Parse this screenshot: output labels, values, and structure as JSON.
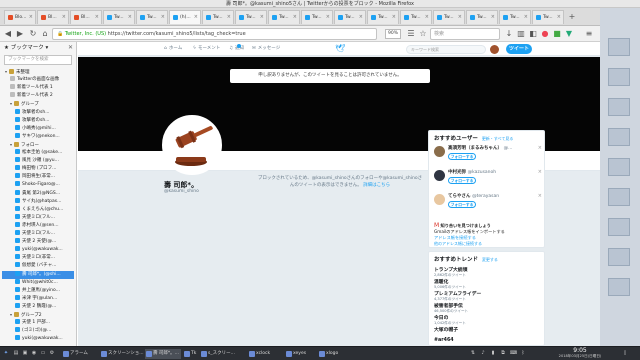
{
  "window": {
    "title": "壽 司郎*。@kasumi_shino5さん | Twitterからの投票をブロック - Mozilla Firefox"
  },
  "tabs": [
    {
      "label": "Blo...",
      "favicon": "ff"
    },
    {
      "label": "Bl...",
      "favicon": "ff"
    },
    {
      "label": "Bl...",
      "favicon": "ff"
    },
    {
      "label": "Tw...",
      "favicon": "tw"
    },
    {
      "label": "Tw...",
      "favicon": "tw"
    },
    {
      "label": "(h)...",
      "favicon": "tw"
    },
    {
      "label": "Tw...",
      "favicon": "tw"
    },
    {
      "label": "Tw...",
      "favicon": "tw"
    },
    {
      "label": "Tw...",
      "favicon": "tw"
    },
    {
      "label": "Tw...",
      "favicon": "tw"
    },
    {
      "label": "Tw...",
      "favicon": "tw"
    },
    {
      "label": "Tw...",
      "favicon": "tw"
    },
    {
      "label": "Tw...",
      "favicon": "tw"
    },
    {
      "label": "Tw...",
      "favicon": "tw"
    },
    {
      "label": "Tw...",
      "favicon": "tw"
    },
    {
      "label": "Tw...",
      "favicon": "tw"
    },
    {
      "label": "Tw...",
      "favicon": "tw"
    }
  ],
  "nav": {
    "url_org": "Twitter, Inc. (US)",
    "url": "https://twitter.com/kasumi_shino5/lists/tag_check=true",
    "zoom": "90%",
    "search_placeholder": "検索"
  },
  "sidebar": {
    "title": "ブックマーク",
    "search_placeholder": "ブックマークを検索",
    "items": [
      {
        "label": "未整理",
        "kind": "folder",
        "indent": 1
      },
      {
        "label": "Twitterの画面な画像",
        "kind": "page",
        "indent": 2
      },
      {
        "label": "新着ツール代表 1",
        "kind": "page",
        "indent": 2
      },
      {
        "label": "新着ツール代表 2",
        "kind": "page",
        "indent": 2
      },
      {
        "label": "グループ",
        "kind": "folder",
        "indent": 2
      },
      {
        "label": "攻撃者のsh...",
        "kind": "tw",
        "indent": 3
      },
      {
        "label": "攻撃者のsh...",
        "kind": "tw",
        "indent": 3
      },
      {
        "label": "小嶋秀(@mihi...",
        "kind": "tw",
        "indent": 3
      },
      {
        "label": "サキワ(@nekon...",
        "kind": "tw",
        "indent": 3
      },
      {
        "label": "フォロー",
        "kind": "folder",
        "indent": 2
      },
      {
        "label": "松本圭佑 (@sake...",
        "kind": "tw",
        "indent": 3
      },
      {
        "label": "風見 沙羅 (@yu...",
        "kind": "tw",
        "indent": 3
      },
      {
        "label": "梅田物 (プロフ...",
        "kind": "tw",
        "indent": 3
      },
      {
        "label": "岡田将生(非常...",
        "kind": "tw",
        "indent": 3
      },
      {
        "label": "Shoko-Figaro@...",
        "kind": "tw",
        "indent": 3
      },
      {
        "label": "貴尾 第2(@NGS...",
        "kind": "tw",
        "indent": 3
      },
      {
        "label": "サイ丸(@hatpas...",
        "kind": "tw",
        "indent": 3
      },
      {
        "label": "くまえちん(@chu...",
        "kind": "tw",
        "indent": 3
      },
      {
        "label": "天使ミロ(フル...",
        "kind": "tw",
        "indent": 3
      },
      {
        "label": "赤村瑛人(@sen...",
        "kind": "tw",
        "indent": 3
      },
      {
        "label": "天使ミロ(フル...",
        "kind": "tw",
        "indent": 3
      },
      {
        "label": "天使 2 天使(@...",
        "kind": "tw",
        "indent": 3
      },
      {
        "label": "yuki(@wakuwak...",
        "kind": "tw",
        "indent": 3
      },
      {
        "label": "天使ミロ(非常...",
        "kind": "tw",
        "indent": 3
      },
      {
        "label": "仮想愛 (バチャ...",
        "kind": "tw",
        "indent": 3
      },
      {
        "label": "壽 司郎*。(@shi...",
        "kind": "tw",
        "indent": 3,
        "selected": true
      },
      {
        "label": "Whit(@whit0c...",
        "kind": "tw",
        "indent": 3
      },
      {
        "label": "井上蓮馬(@yino...",
        "kind": "tw",
        "indent": 3
      },
      {
        "label": "米津 宇(@ulan...",
        "kind": "tw",
        "indent": 3
      },
      {
        "label": "天使 2 鶴霞(@...",
        "kind": "tw",
        "indent": 3
      },
      {
        "label": "グループ2",
        "kind": "folder",
        "indent": 2
      },
      {
        "label": "天使 1 戸部...",
        "kind": "tw",
        "indent": 3
      },
      {
        "label": "(ゴミ(ゴ)(@...",
        "kind": "tw",
        "indent": 3
      },
      {
        "label": "yuki(@wakuwak...",
        "kind": "tw",
        "indent": 3
      }
    ]
  },
  "twitter": {
    "nav": {
      "home": "ホーム",
      "moments": "モーメント",
      "notifications": "通知",
      "messages": "メッセージ",
      "search_placeholder": "キーワード検索",
      "tweet": "ツイート"
    },
    "blocked_banner": "申し訳ありませんが、このツイートを見ることは許可されていません。",
    "profile": {
      "name": "壽 司郎*。",
      "handle": "@kasumi_shino"
    },
    "block_notice": {
      "text": "ブロックされているため、@kasumi_shinoさんのフォローや@kasumi_shinoさんのツイートの表示はできません。",
      "link": "詳細はこちら"
    },
    "who_to_follow": {
      "title": "おすすめユーザー",
      "links": "更新・すべて見る",
      "users": [
        {
          "name": "高須芳明（まるみちゃん）",
          "handle": "@...",
          "follow": "フォローする",
          "avatar_color": "#8a6d4b"
        },
        {
          "name": "中村光弥",
          "handle": "@kazusanoh",
          "follow": "フォローする",
          "avatar_color": "#2f3542"
        },
        {
          "name": "てらやさん",
          "handle": "@terayasan",
          "follow": "フォローする",
          "avatar_color": "#e8c7a0"
        }
      ],
      "find_friends_title": "知り合いを見つけましょう",
      "find_friends_text": "Gmailのアドレス帳をインポートする",
      "find_friends_link": "アドレス帳を接続する",
      "all_users": "他のアドレス帳に接続する"
    },
    "trends": {
      "title": "おすすめトレンド",
      "change": "変更する",
      "items": [
        {
          "name": "トランプ大統領",
          "count": "2,862件のツイート"
        },
        {
          "name": "温暖化",
          "count": "5,006件のツイート"
        },
        {
          "name": "プレミアムフライデー",
          "count": "4,377件のツイート"
        },
        {
          "name": "被害者部手伝",
          "count": "46,500件のツイート"
        },
        {
          "name": "今日の",
          "count": "1,042件のツイート"
        },
        {
          "name": "大塚の帽子",
          "count": ""
        },
        {
          "name": "#ar464",
          "count": ""
        }
      ]
    }
  },
  "taskbar": {
    "tasks": [
      {
        "label": "アラーム"
      },
      {
        "label": "スクリーンショ..."
      },
      {
        "label": "壽 司郎*。..."
      },
      {
        "label": "Tk"
      },
      {
        "label": "s_スクリー..."
      },
      {
        "label": "xclock"
      },
      {
        "label": "xeyes"
      },
      {
        "label": "xlogo"
      }
    ],
    "clock_time": "9:05",
    "clock_date": "2018年03月25日(日曜日)"
  },
  "colors": {
    "twitter_blue": "#1da1f2",
    "banner": "#050505",
    "gavel": "#8b3a1a"
  }
}
